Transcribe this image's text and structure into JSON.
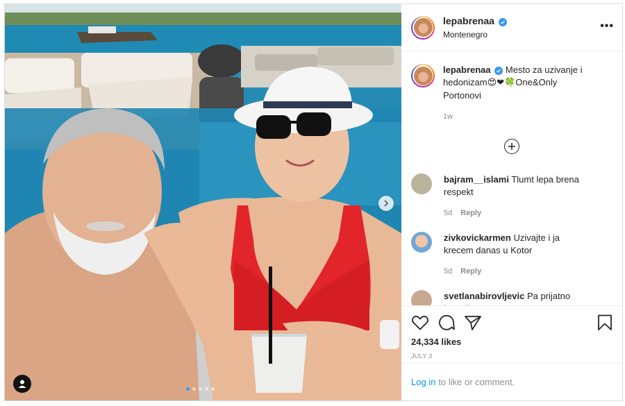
{
  "post": {
    "username": "lepabrenaa",
    "location": "Montenegro",
    "caption": {
      "username": "lepabrenaa",
      "text": "Mesto za uzivanje i hedonizam",
      "emojis": "😍❤🍀",
      "text_after": "One&Only Portonovi",
      "time": "1w"
    },
    "comments": [
      {
        "username": "bajram__islami",
        "text": "Tlumt lepa brena respekt",
        "time": "5d",
        "reply": "Reply",
        "avatar_color": "#b8b39a"
      },
      {
        "username": "zivkovickarmen",
        "text": "Uzivajte i ja krecem danas u Kotor",
        "time": "5d",
        "reply": "Reply",
        "avatar_color": "#e0a58a"
      },
      {
        "username": "svetlanabirovljevic",
        "text": "Pa prijatno komsije",
        "time": "",
        "reply": "",
        "avatar_color": "#c8a890"
      }
    ],
    "likes": "24,334 likes",
    "date": "JULY 3",
    "login": {
      "link": "Log in",
      "text": "to like or comment."
    }
  },
  "carousel": {
    "slides": 5,
    "active": 0
  },
  "icons": {
    "verified": "verified-badge-icon",
    "more": "more-options-icon",
    "load_more": "load-more-comments-icon",
    "like": "heart-icon",
    "comment": "comment-icon",
    "share": "share-icon",
    "save": "bookmark-icon",
    "next": "chevron-right-icon",
    "tag": "user-tag-icon"
  },
  "colors": {
    "link": "#0095f6",
    "muted": "#8e8e8e",
    "verified": "#3897f0",
    "active_dot": "#3897f0"
  }
}
